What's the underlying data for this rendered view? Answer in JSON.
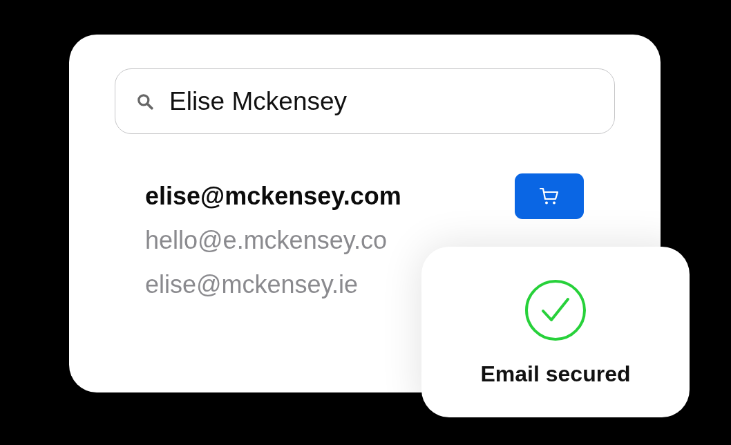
{
  "search": {
    "value": "Elise Mckensey"
  },
  "emails": [
    {
      "address": "elise@mckensey.com",
      "selected": true
    },
    {
      "address": "hello@e.mckensey.co",
      "selected": false
    },
    {
      "address": "elise@mckensey.ie",
      "selected": false
    }
  ],
  "toast": {
    "title": "Email secured"
  }
}
